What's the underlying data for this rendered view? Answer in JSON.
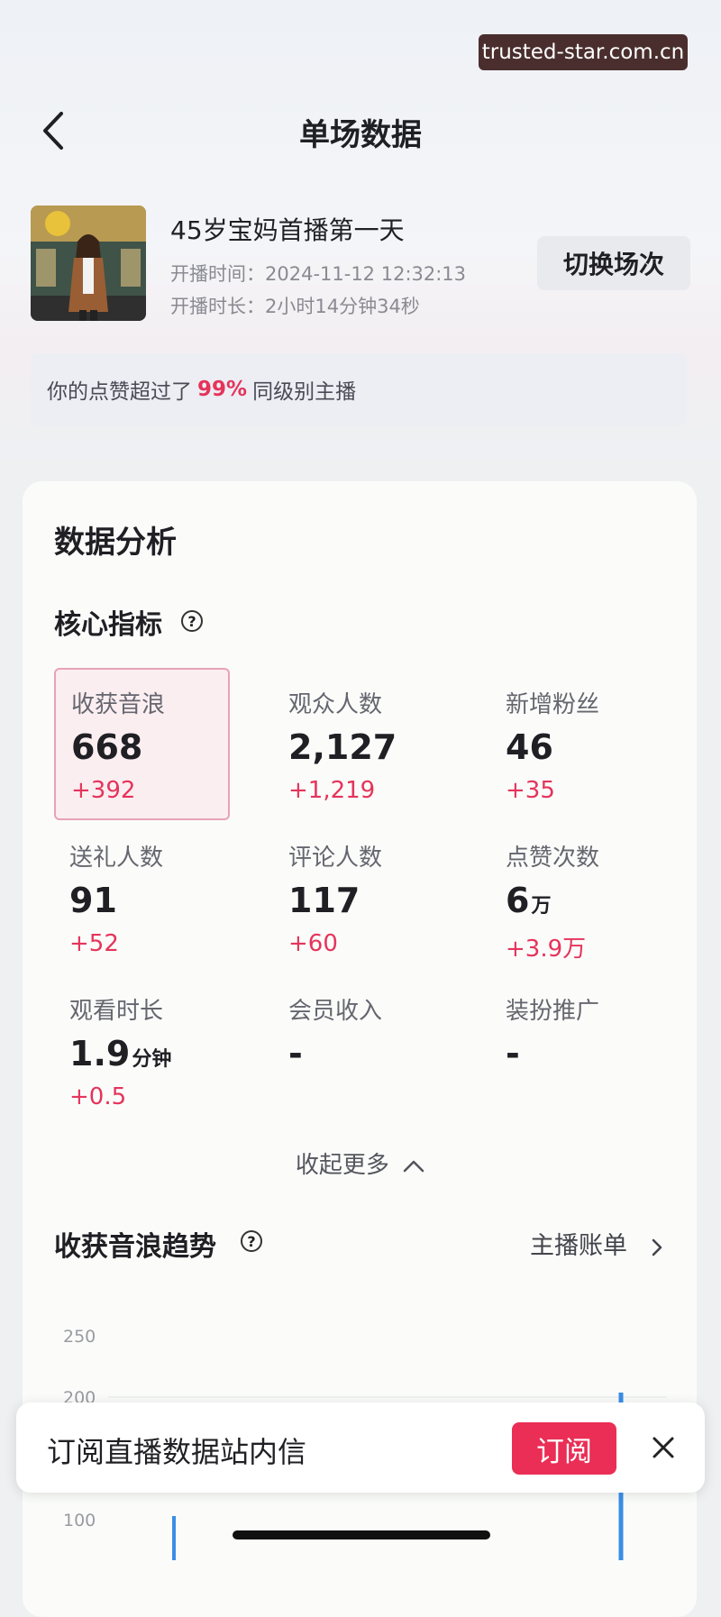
{
  "watermark": "trusted-star.com.cn",
  "header": {
    "title": "单场数据"
  },
  "session": {
    "title": "45岁宝妈首播第一天",
    "start_time": "开播时间：2024-11-12 12:32:13",
    "duration": "开播时长：2小时14分钟34秒",
    "switch_label": "切换场次"
  },
  "rank": {
    "prefix": "你的点赞超过了",
    "percent": "99%",
    "suffix": "同级别主播"
  },
  "analysis": {
    "title": "数据分析",
    "core_title": "核心指标",
    "metrics": [
      {
        "label": "收获音浪",
        "value": "668",
        "unit": "",
        "delta": "+392"
      },
      {
        "label": "观众人数",
        "value": "2,127",
        "unit": "",
        "delta": "+1,219"
      },
      {
        "label": "新增粉丝",
        "value": "46",
        "unit": "",
        "delta": "+35"
      },
      {
        "label": "送礼人数",
        "value": "91",
        "unit": "",
        "delta": "+52"
      },
      {
        "label": "评论人数",
        "value": "117",
        "unit": "",
        "delta": "+60"
      },
      {
        "label": "点赞次数",
        "value": "6",
        "unit": "万",
        "delta": "+3.9万"
      },
      {
        "label": "观看时长",
        "value": "1.9",
        "unit": "分钟",
        "delta": "+0.5"
      },
      {
        "label": "会员收入",
        "value": "-",
        "unit": "",
        "delta": ""
      },
      {
        "label": "装扮推广",
        "value": "-",
        "unit": "",
        "delta": ""
      }
    ],
    "collapse_label": "收起更多"
  },
  "trend": {
    "title": "收获音浪趋势",
    "link_label": "主播账单",
    "y_ticks": [
      "250",
      "200",
      "100"
    ]
  },
  "subscribe": {
    "text": "订阅直播数据站内信",
    "button": "订阅"
  },
  "colors": {
    "accent": "#e5345b",
    "subscribe": "#ea2e55",
    "chart_line": "#3a8ee6"
  }
}
